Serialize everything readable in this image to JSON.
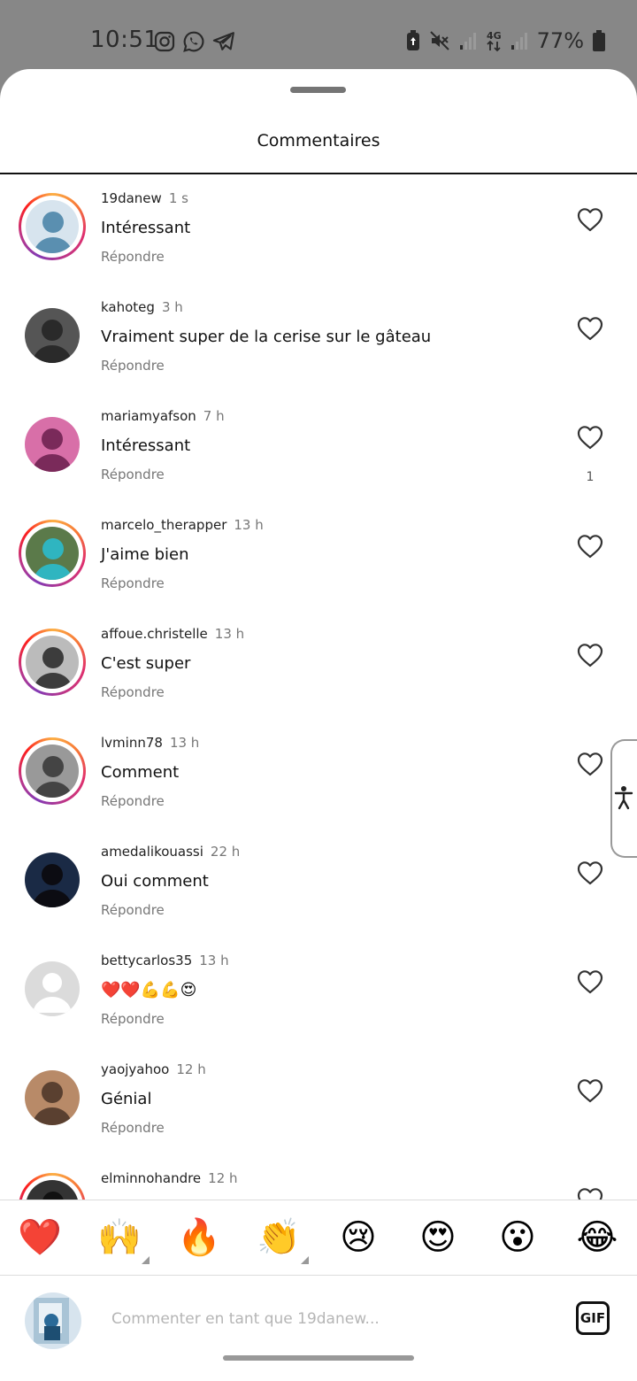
{
  "status_bar": {
    "time": "10:51",
    "battery": "77%",
    "icons_left": [
      "instagram-icon",
      "whatsapp-icon",
      "telegram-icon"
    ],
    "icons_right": [
      "battery-saver-icon",
      "mute-icon",
      "signal-icon",
      "4g-icon",
      "signal-icon",
      "battery-icon"
    ]
  },
  "sheet": {
    "title": "Commentaires"
  },
  "comments": [
    {
      "username": "19danew",
      "time": "1 s",
      "text": "Intéressant",
      "reply": "Répondre",
      "likes": "",
      "ring": true,
      "avatar_colors": [
        "#5a8fb0",
        "#d7e4ee"
      ]
    },
    {
      "username": "kahoteg",
      "time": "3 h",
      "text": "Vraiment super de la cerise sur le gâteau",
      "reply": "Répondre",
      "likes": "",
      "ring": false,
      "avatar_colors": [
        "#2a2a2a",
        "#555"
      ]
    },
    {
      "username": "mariamyafson",
      "time": "7 h",
      "text": "Intéressant",
      "reply": "Répondre",
      "likes": "1",
      "ring": false,
      "avatar_colors": [
        "#7a2a5a",
        "#d86fa8"
      ]
    },
    {
      "username": "marcelo_therapper",
      "time": "13 h",
      "text": "J'aime bien",
      "reply": "Répondre",
      "likes": "",
      "ring": true,
      "avatar_colors": [
        "#2fb5c0",
        "#5b7a4a"
      ]
    },
    {
      "username": "affoue.christelle",
      "time": "13 h",
      "text": "C'est super",
      "reply": "Répondre",
      "likes": "",
      "ring": true,
      "avatar_colors": [
        "#3c3c3c",
        "#bbbbbb"
      ]
    },
    {
      "username": "lvminn78",
      "time": "13 h",
      "text": "Comment",
      "reply": "Répondre",
      "likes": "",
      "ring": true,
      "avatar_colors": [
        "#444",
        "#999"
      ]
    },
    {
      "username": "amedalikouassi",
      "time": "22 h",
      "text": "Oui comment",
      "reply": "Répondre",
      "likes": "",
      "ring": false,
      "avatar_colors": [
        "#0c0c12",
        "#1a2a45"
      ]
    },
    {
      "username": "bettycarlos35",
      "time": "13 h",
      "text": "❤️❤️💪💪😍",
      "reply": "Répondre",
      "likes": "",
      "ring": false,
      "default_avatar": true,
      "avatar_colors": [
        "#dbdbdb",
        "#ffffff"
      ]
    },
    {
      "username": "yaojyahoo",
      "time": "12 h",
      "text": "Génial",
      "reply": "Répondre",
      "likes": "",
      "ring": false,
      "avatar_colors": [
        "#5a4030",
        "#b88a68"
      ]
    },
    {
      "username": "elminnohandre",
      "time": "12 h",
      "text": "",
      "reply": "",
      "likes": "",
      "ring": true,
      "avatar_colors": [
        "#111",
        "#333"
      ]
    }
  ],
  "reactions": [
    "❤️",
    "🙌",
    "🔥",
    "👏",
    "😢",
    "😍",
    "😮",
    "😂"
  ],
  "composer": {
    "placeholder": "Commenter en tant que 19danew...",
    "gif_label": "GIF"
  },
  "colors": {
    "accent": "#e1306c",
    "text": "#111111",
    "muted": "#777777"
  }
}
